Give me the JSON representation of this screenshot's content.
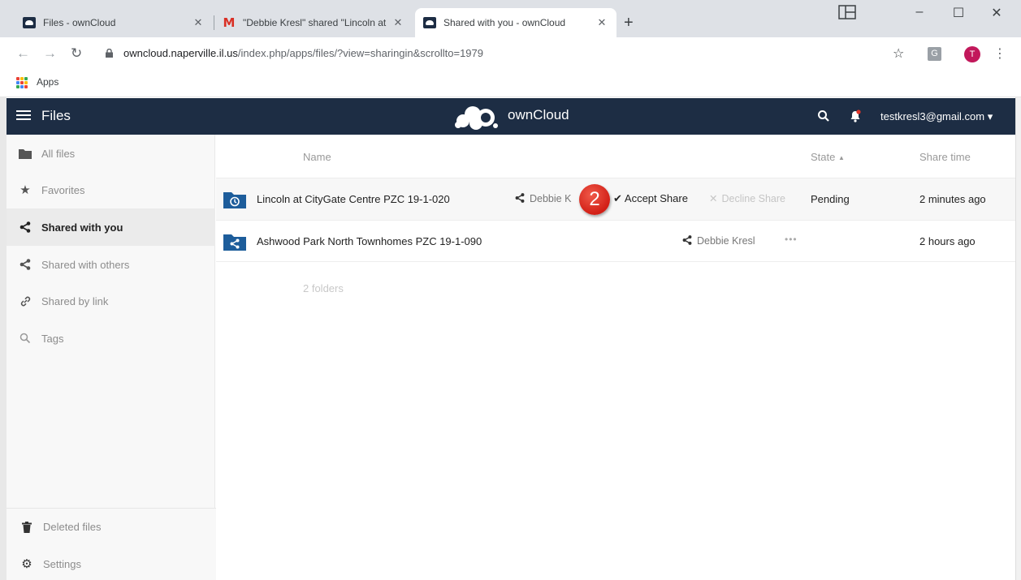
{
  "browser": {
    "tabs": [
      {
        "title": "Files - ownCloud",
        "favicon": "owncloud-icon"
      },
      {
        "title": "\"Debbie Kresl\" shared \"Lincoln at",
        "favicon": "gmail-icon"
      },
      {
        "title": "Shared with you - ownCloud",
        "favicon": "owncloud-icon"
      }
    ],
    "url_host": "owncloud.naperville.il.us",
    "url_path": "/index.php/apps/files/?view=sharingin&scrollto=1979",
    "bookmarks_apps": "Apps",
    "avatar_letter": "T"
  },
  "header": {
    "section": "Files",
    "brand": "ownCloud",
    "user": "testkresl3@gmail.com"
  },
  "sidebar": {
    "items": [
      {
        "label": "All files",
        "icon": "folder-icon"
      },
      {
        "label": "Favorites",
        "icon": "star-icon"
      },
      {
        "label": "Shared with you",
        "icon": "share-icon"
      },
      {
        "label": "Shared with others",
        "icon": "share-icon"
      },
      {
        "label": "Shared by link",
        "icon": "link-icon"
      },
      {
        "label": "Tags",
        "icon": "search-icon"
      }
    ],
    "bottom": [
      {
        "label": "Deleted files",
        "icon": "trash-icon"
      },
      {
        "label": "Settings",
        "icon": "gear-icon"
      }
    ]
  },
  "files": {
    "columns": {
      "name": "Name",
      "state": "State",
      "share_time": "Share time"
    },
    "rows": [
      {
        "name": "Lincoln at CityGate Centre PZC 19-1-020",
        "sharer": "Debbie K",
        "accept": "Accept Share",
        "decline": "Decline Share",
        "state": "Pending",
        "time": "2 minutes ago"
      },
      {
        "name": "Ashwood Park North Townhomes PZC 19-1-090",
        "sharer": "Debbie Kresl",
        "more": "•••",
        "state": "",
        "time": "2 hours ago"
      }
    ],
    "summary": "2 folders"
  },
  "callout": {
    "number": "2"
  },
  "colors": {
    "header_bg": "#1d2d44",
    "folder_blue": "#1d5d9b",
    "callout_red": "#e0352a"
  }
}
